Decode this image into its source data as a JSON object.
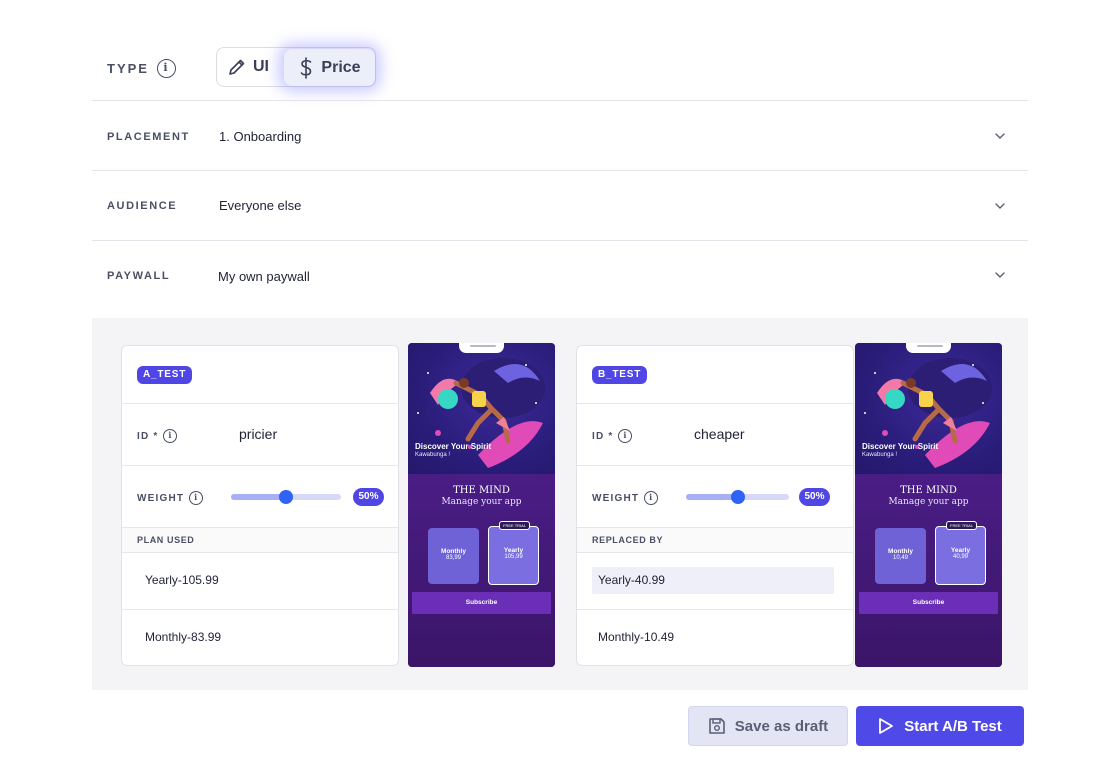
{
  "type": {
    "label": "TYPE",
    "info_icon": "i",
    "options": [
      "UI",
      "Price"
    ],
    "selected": "Price"
  },
  "rows": [
    {
      "label": "PLACEMENT",
      "value": "1. Onboarding"
    },
    {
      "label": "AUDIENCE",
      "value": "Everyone else"
    },
    {
      "label": "PAYWALL",
      "value": "My own paywall"
    }
  ],
  "variants": [
    {
      "tag": "A_TEST",
      "id_label": "ID *",
      "id_value": "pricier",
      "weight_label": "WEIGHT",
      "weight_pct": "50%",
      "weight_fraction": 0.5,
      "plans_header": "PLAN USED",
      "plans": [
        "Yearly-105.99",
        "Monthly-83.99"
      ],
      "preview": {
        "hero_title": "Discover Your Spirit",
        "hero_subtitle": "Kawabunga !",
        "brand": "THE MIND",
        "tagline": "Manage your app",
        "monthly_label": "Monthly",
        "monthly_price": "83,99",
        "yearly_label": "Yearly",
        "yearly_price": "105,99",
        "trial_badge": "FREE TRIAL",
        "subscribe": "Subscribe"
      }
    },
    {
      "tag": "B_TEST",
      "id_label": "ID *",
      "id_value": "cheaper",
      "weight_label": "WEIGHT",
      "weight_pct": "50%",
      "weight_fraction": 0.5,
      "plans_header": "REPLACED BY",
      "plans": [
        "Yearly-40.99",
        "Monthly-10.49"
      ],
      "preview": {
        "hero_title": "Discover Your Spirit",
        "hero_subtitle": "Kawabunga !",
        "brand": "THE MIND",
        "tagline": "Manage your app",
        "monthly_label": "Monthly",
        "monthly_price": "10,49",
        "yearly_label": "Yearly",
        "yearly_price": "40,99",
        "trial_badge": "FREE TRIAL",
        "subscribe": "Subscribe"
      }
    }
  ],
  "actions": {
    "save_draft": "Save as draft",
    "start": "Start A/B Test"
  },
  "colors": {
    "accent": "#5046e5",
    "primary_button": "#4f49e8",
    "slider_knob": "#2e63f6",
    "panel_bg": "#f4f4f6"
  }
}
